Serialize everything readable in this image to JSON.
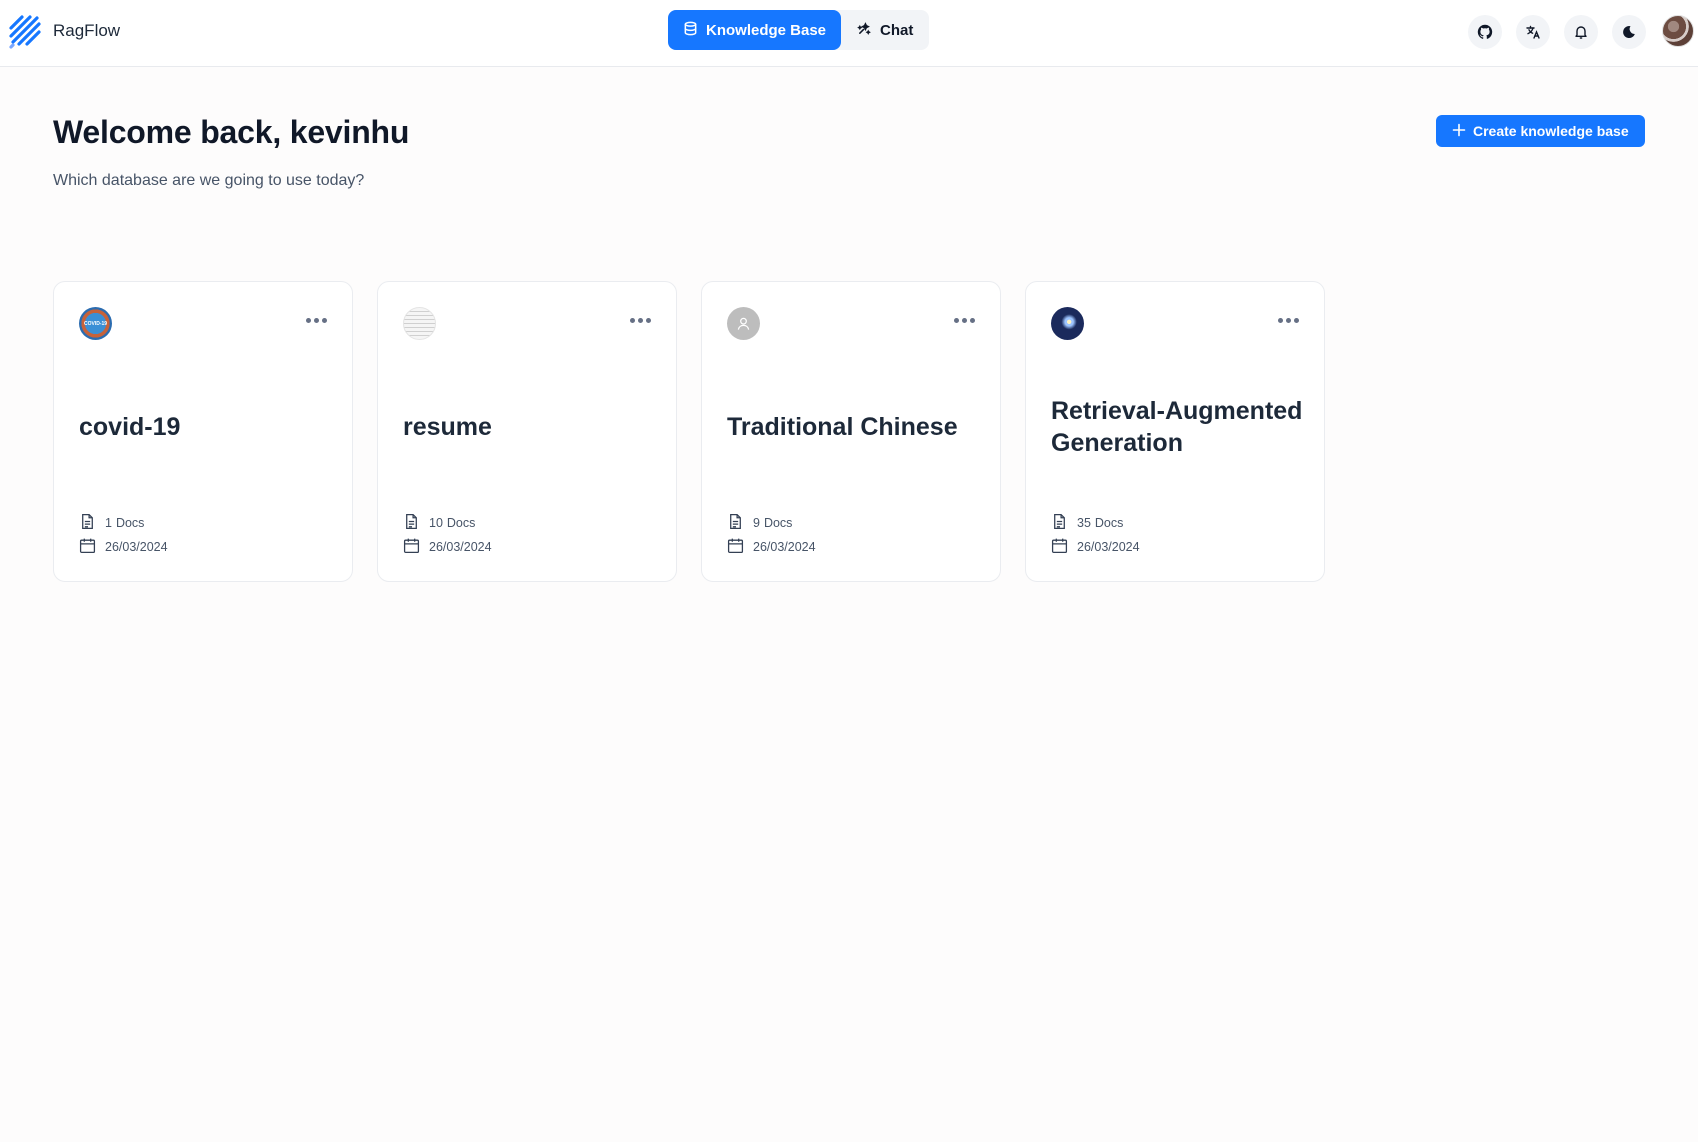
{
  "app": {
    "name": "RagFlow"
  },
  "nav": {
    "tabs": [
      {
        "label": "Knowledge Base",
        "icon": "database-icon",
        "active": true
      },
      {
        "label": "Chat",
        "icon": "chat-icon",
        "active": false
      }
    ]
  },
  "header_icons": [
    "github-icon",
    "translate-icon",
    "bell-icon",
    "moon-icon"
  ],
  "welcome": {
    "title": "Welcome back, kevinhu",
    "subtitle": "Which database are we going to use today?"
  },
  "create_button": {
    "label": "Create knowledge base",
    "icon": "plus-icon"
  },
  "colors": {
    "accent": "#1677ff",
    "background": "#fdfcfc",
    "card_border": "#eaecf0"
  },
  "knowledge_bases": [
    {
      "name": "covid-19",
      "doc_count": "1",
      "docs_label": "Docs",
      "date": "26/03/2024",
      "avatar": "covid-avatar"
    },
    {
      "name": "resume",
      "doc_count": "10",
      "docs_label": "Docs",
      "date": "26/03/2024",
      "avatar": "resume-avatar"
    },
    {
      "name": "Traditional Chinese",
      "doc_count": "9",
      "docs_label": "Docs",
      "date": "26/03/2024",
      "avatar": "default-user-avatar"
    },
    {
      "name": "Retrieval-Augmented Generation",
      "doc_count": "35",
      "docs_label": "Docs",
      "date": "26/03/2024",
      "avatar": "rag-avatar"
    }
  ]
}
